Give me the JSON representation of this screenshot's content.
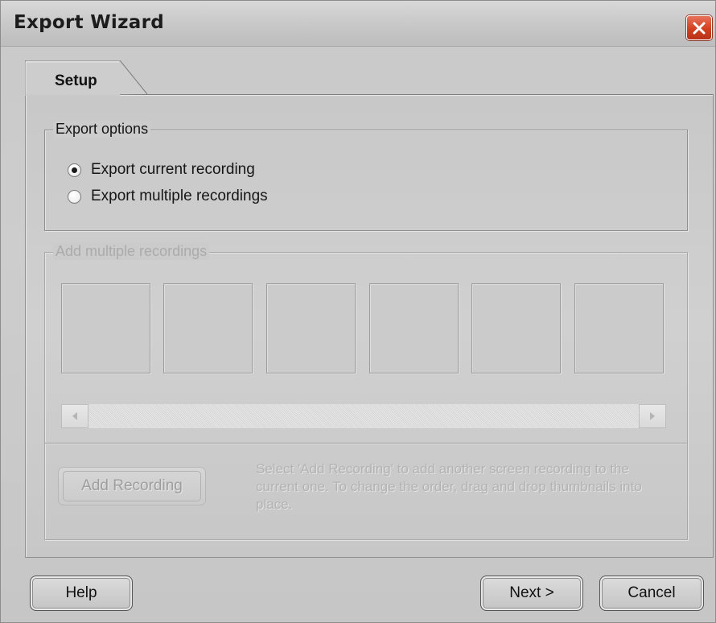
{
  "window": {
    "title": "Export Wizard"
  },
  "tabs": [
    {
      "label": "Setup",
      "active": true
    }
  ],
  "export_options": {
    "legend": "Export options",
    "options": [
      {
        "label": "Export current recording",
        "checked": true
      },
      {
        "label": "Export multiple recordings",
        "checked": false
      }
    ]
  },
  "multiple_recordings": {
    "legend": "Add multiple recordings",
    "enabled": false,
    "thumbnail_slots": 6,
    "add_button_label": "Add Recording",
    "hint": "Select 'Add Recording' to add another screen recording to the current one. To change the order, drag and drop thumbnails into place."
  },
  "footer": {
    "help_label": "Help",
    "next_label": "Next >",
    "cancel_label": "Cancel"
  },
  "colors": {
    "close_button": "#d2411f",
    "disabled_text": "#ababab"
  }
}
